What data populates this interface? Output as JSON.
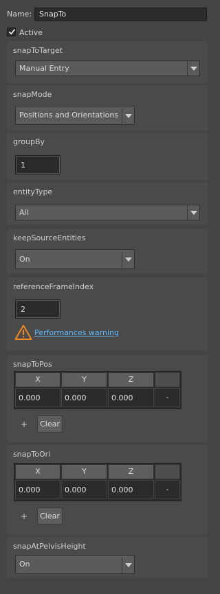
{
  "header": {
    "name_label": "Name:",
    "name_value": "SnapTo",
    "active_label": "Active",
    "active_checked": true
  },
  "fields": {
    "snapToTarget": {
      "label": "snapToTarget",
      "value": "Manual Entry"
    },
    "snapMode": {
      "label": "snapMode",
      "value": "Positions and Orientations"
    },
    "groupBy": {
      "label": "groupBy",
      "value": "1"
    },
    "entityType": {
      "label": "entityType",
      "value": "All"
    },
    "keepSourceEntities": {
      "label": "keepSourceEntities",
      "value": "On"
    },
    "referenceFrameIndex": {
      "label": "referenceFrameIndex",
      "value": "2",
      "warning_text": "Performances warning",
      "warning_color": "#f08a24"
    },
    "snapToPos": {
      "label": "snapToPos",
      "columns": [
        "X",
        "Y",
        "Z",
        ""
      ],
      "rows": [
        [
          "0.000",
          "0.000",
          "0.000",
          "-"
        ]
      ],
      "add_label": "+",
      "clear_label": "Clear"
    },
    "snapToOri": {
      "label": "snapToOri",
      "columns": [
        "X",
        "Y",
        "Z",
        ""
      ],
      "rows": [
        [
          "0.000",
          "0.000",
          "0.000",
          "-"
        ]
      ],
      "add_label": "+",
      "clear_label": "Clear"
    },
    "snapAtPelvisHeight": {
      "label": "snapAtPelvisHeight",
      "value": "On"
    }
  },
  "colors": {
    "background": "#444444",
    "panel": "#4a4a4a",
    "link": "#5fb9ff",
    "warning": "#f08a24"
  }
}
